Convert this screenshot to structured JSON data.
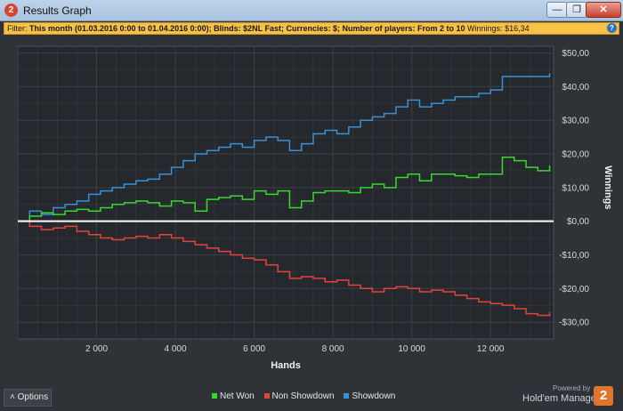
{
  "window": {
    "title": "Results Graph",
    "logo_text": "2",
    "controls": {
      "minimize": "—",
      "restore": "❐",
      "close": "✕"
    }
  },
  "filter": {
    "label": "Filter:",
    "text": "This month (01.03.2016 0:00 to 01.04.2016 0:00); Blinds: $2NL Fast; Currencies: $; Number of players: From 2 to 10",
    "winnings_label": "Winnings:",
    "winnings_value": "$16,34",
    "help_icon": "?"
  },
  "bottom": {
    "options_label": "Options",
    "options_icon": "˄",
    "powered_by": "Powered by",
    "brand_name": "Hold'em Manager",
    "brand_badge": "2"
  },
  "colors": {
    "net_won": "#39d830",
    "non_showdown": "#e4433b",
    "showdown": "#3b8fd4",
    "zero_line": "#ffffff",
    "plot_bg": "#25292d",
    "grid": "#3c4147"
  },
  "chart_data": {
    "type": "line",
    "xlabel": "Hands",
    "ylabel": "Winnings",
    "xlim": [
      0,
      13600
    ],
    "ylim": [
      -35,
      52
    ],
    "x_ticks": [
      2000,
      4000,
      6000,
      8000,
      10000,
      12000
    ],
    "x_tick_labels": [
      "2 000",
      "4 000",
      "6 000",
      "8 000",
      "10 000",
      "12 000"
    ],
    "y_ticks": [
      50,
      40,
      30,
      20,
      10,
      0,
      -10,
      -20,
      -30
    ],
    "y_tick_labels": [
      "$50,00",
      "$40,00",
      "$30,00",
      "$20,00",
      "$10,00",
      "$0,00",
      "-$10,00",
      "-$20,00",
      "-$30,00"
    ],
    "grid": true,
    "legend_position": "bottom",
    "series": [
      {
        "name": "Net Won",
        "x": [
          0,
          300,
          600,
          900,
          1200,
          1500,
          1800,
          2100,
          2400,
          2700,
          3000,
          3300,
          3600,
          3900,
          4200,
          4500,
          4800,
          5100,
          5400,
          5700,
          6000,
          6300,
          6600,
          6900,
          7200,
          7500,
          7800,
          8100,
          8400,
          8700,
          9000,
          9300,
          9600,
          9900,
          10200,
          10500,
          10800,
          11100,
          11400,
          11700,
          12000,
          12300,
          12600,
          12900,
          13200,
          13500
        ],
        "values": [
          0,
          1.5,
          2.5,
          2,
          3,
          3.5,
          3,
          4,
          5,
          5.5,
          6,
          5.5,
          4.5,
          6,
          5.5,
          3,
          6.5,
          7,
          7.5,
          6.5,
          9,
          8,
          9,
          4,
          6,
          8.5,
          9,
          9,
          8.5,
          10,
          11,
          10,
          13,
          14,
          12,
          14,
          14,
          13.5,
          13,
          14,
          14,
          19,
          18,
          16,
          15,
          16.5
        ]
      },
      {
        "name": "Non Showdown",
        "x": [
          0,
          300,
          600,
          900,
          1200,
          1500,
          1800,
          2100,
          2400,
          2700,
          3000,
          3300,
          3600,
          3900,
          4200,
          4500,
          4800,
          5100,
          5400,
          5700,
          6000,
          6300,
          6600,
          6900,
          7200,
          7500,
          7800,
          8100,
          8400,
          8700,
          9000,
          9300,
          9600,
          9900,
          10200,
          10500,
          10800,
          11100,
          11400,
          11700,
          12000,
          12300,
          12600,
          12900,
          13200,
          13500
        ],
        "values": [
          0,
          -1.5,
          -2.5,
          -2,
          -1.5,
          -3,
          -4,
          -5,
          -5.5,
          -5,
          -4.5,
          -5,
          -4,
          -5,
          -6,
          -7,
          -8,
          -9,
          -10,
          -11,
          -11.5,
          -13,
          -15,
          -17,
          -16.5,
          -17,
          -18,
          -17.5,
          -19,
          -20,
          -21,
          -20,
          -19.5,
          -20,
          -21,
          -20.5,
          -21,
          -22,
          -23,
          -24,
          -24.5,
          -25,
          -26,
          -27.5,
          -28,
          -27
        ]
      },
      {
        "name": "Showdown",
        "x": [
          0,
          300,
          600,
          900,
          1200,
          1500,
          1800,
          2100,
          2400,
          2700,
          3000,
          3300,
          3600,
          3900,
          4200,
          4500,
          4800,
          5100,
          5400,
          5700,
          6000,
          6300,
          6600,
          6900,
          7200,
          7500,
          7800,
          8100,
          8400,
          8700,
          9000,
          9300,
          9600,
          9900,
          10200,
          10500,
          10800,
          11100,
          11400,
          11700,
          12000,
          12300,
          12600,
          12900,
          13200,
          13500
        ],
        "values": [
          0,
          3,
          2,
          4,
          5,
          6,
          8,
          9,
          10,
          11,
          12,
          12.5,
          14,
          16,
          18,
          20,
          21,
          22,
          23,
          22,
          24,
          25,
          24,
          21,
          23,
          26,
          27,
          26,
          28,
          30,
          31,
          32,
          34,
          36,
          34,
          35,
          36,
          37,
          37,
          38,
          39,
          43,
          43,
          43,
          43,
          44
        ]
      }
    ]
  }
}
